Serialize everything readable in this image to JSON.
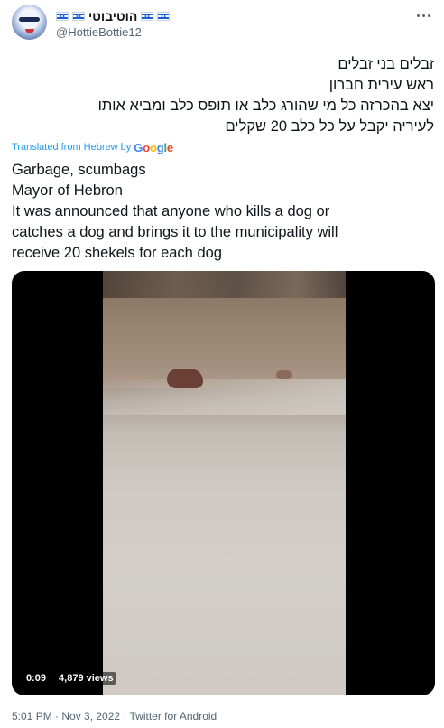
{
  "author": {
    "display_name": "הוטיבוטי",
    "handle": "@HottieBottie12"
  },
  "tweet": {
    "hebrew_lines": [
      "זבלים בני זבלים",
      "ראש עירית חברון",
      "יצא בהכרזה כל מי שהורג כלב או תופס כלב ומביא אותו",
      "לעיריה יקבל על כל כלב 20 שקלים"
    ],
    "translated_label": "Translated from Hebrew by",
    "translated_brand": "Google",
    "english_lines": [
      "Garbage, scumbags",
      "Mayor of Hebron",
      "It was announced that anyone who kills a dog or",
      "catches a dog and brings it to the municipality will",
      "receive 20 shekels for each dog"
    ]
  },
  "video": {
    "duration": "0:09",
    "views": "4,879 views"
  },
  "footer": {
    "text": "5:01 PM · Nov 3, 2022 · Twitter for Android"
  },
  "colors": {
    "link": "#1d9bf0",
    "secondary_text": "#536471",
    "primary_text": "#0f1419"
  },
  "icons": [
    "israel-flag-icon",
    "more-options-icon",
    "avatar"
  ]
}
